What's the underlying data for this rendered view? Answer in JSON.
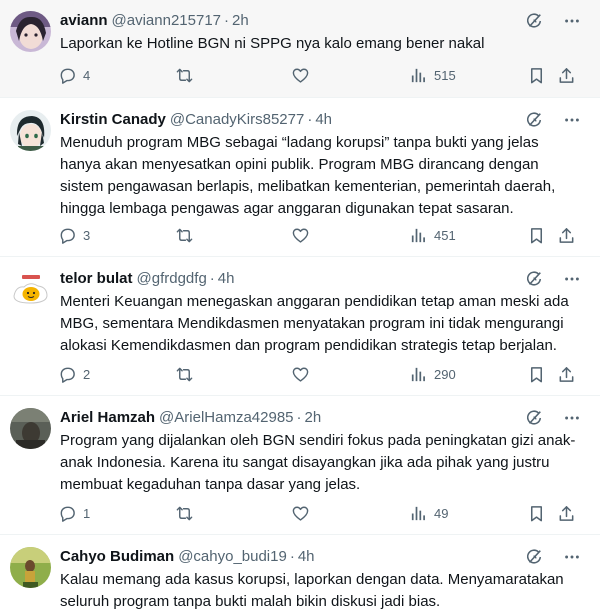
{
  "tweets": [
    {
      "name": "aviann",
      "handle": "@aviann215717",
      "time": "2h",
      "text": "Laporkan ke Hotline BGN ni SPPG nya kalo emang bener nakal",
      "replies": "4",
      "retweets": "",
      "likes": "",
      "views": "515"
    },
    {
      "name": "Kirstin Canady",
      "handle": "@CanadyKirs85277",
      "time": "4h",
      "text": "Menuduh program MBG sebagai “ladang korupsi” tanpa bukti yang jelas hanya akan menyesatkan opini publik. Program MBG dirancang dengan sistem pengawasan berlapis, melibatkan kementerian, pemerintah daerah, hingga lembaga pengawas agar anggaran digunakan tepat sasaran.",
      "replies": "3",
      "retweets": "",
      "likes": "",
      "views": "451"
    },
    {
      "name": "telor bulat",
      "handle": "@gfrdgdfg",
      "time": "4h",
      "text": "Menteri Keuangan menegaskan anggaran pendidikan tetap aman meski ada MBG, sementara Mendikdasmen menyatakan program ini tidak mengurangi alokasi Kemendikdasmen dan program pendidikan strategis tetap berjalan.",
      "replies": "2",
      "retweets": "",
      "likes": "",
      "views": "290"
    },
    {
      "name": "Ariel Hamzah",
      "handle": "@ArielHamza42985",
      "time": "2h",
      "text": "Program yang dijalankan oleh BGN sendiri fokus pada peningkatan gizi anak-anak Indonesia. Karena itu sangat disayangkan jika ada pihak yang justru membuat kegaduhan tanpa dasar yang jelas.",
      "replies": "1",
      "retweets": "",
      "likes": "",
      "views": "49"
    },
    {
      "name": "Cahyo Budiman",
      "handle": "@cahyo_budi19",
      "time": "4h",
      "text": "Kalau memang ada kasus korupsi, laporkan dengan data. Menyamaratakan seluruh program tanpa bukti malah bikin diskusi jadi bias.",
      "replies": "",
      "retweets": "",
      "likes": "",
      "views": ""
    }
  ],
  "separator": "·",
  "icons": {
    "grok": "grok-icon",
    "more": "more-icon",
    "reply": "reply-icon",
    "retweet": "retweet-icon",
    "like": "like-icon",
    "views": "views-icon",
    "bookmark": "bookmark-icon",
    "share": "share-icon"
  },
  "colors": {
    "text": "#0f1419",
    "secondary": "#536471",
    "highlight_bg": "#f7f7f7",
    "divider": "#eff3f4"
  }
}
